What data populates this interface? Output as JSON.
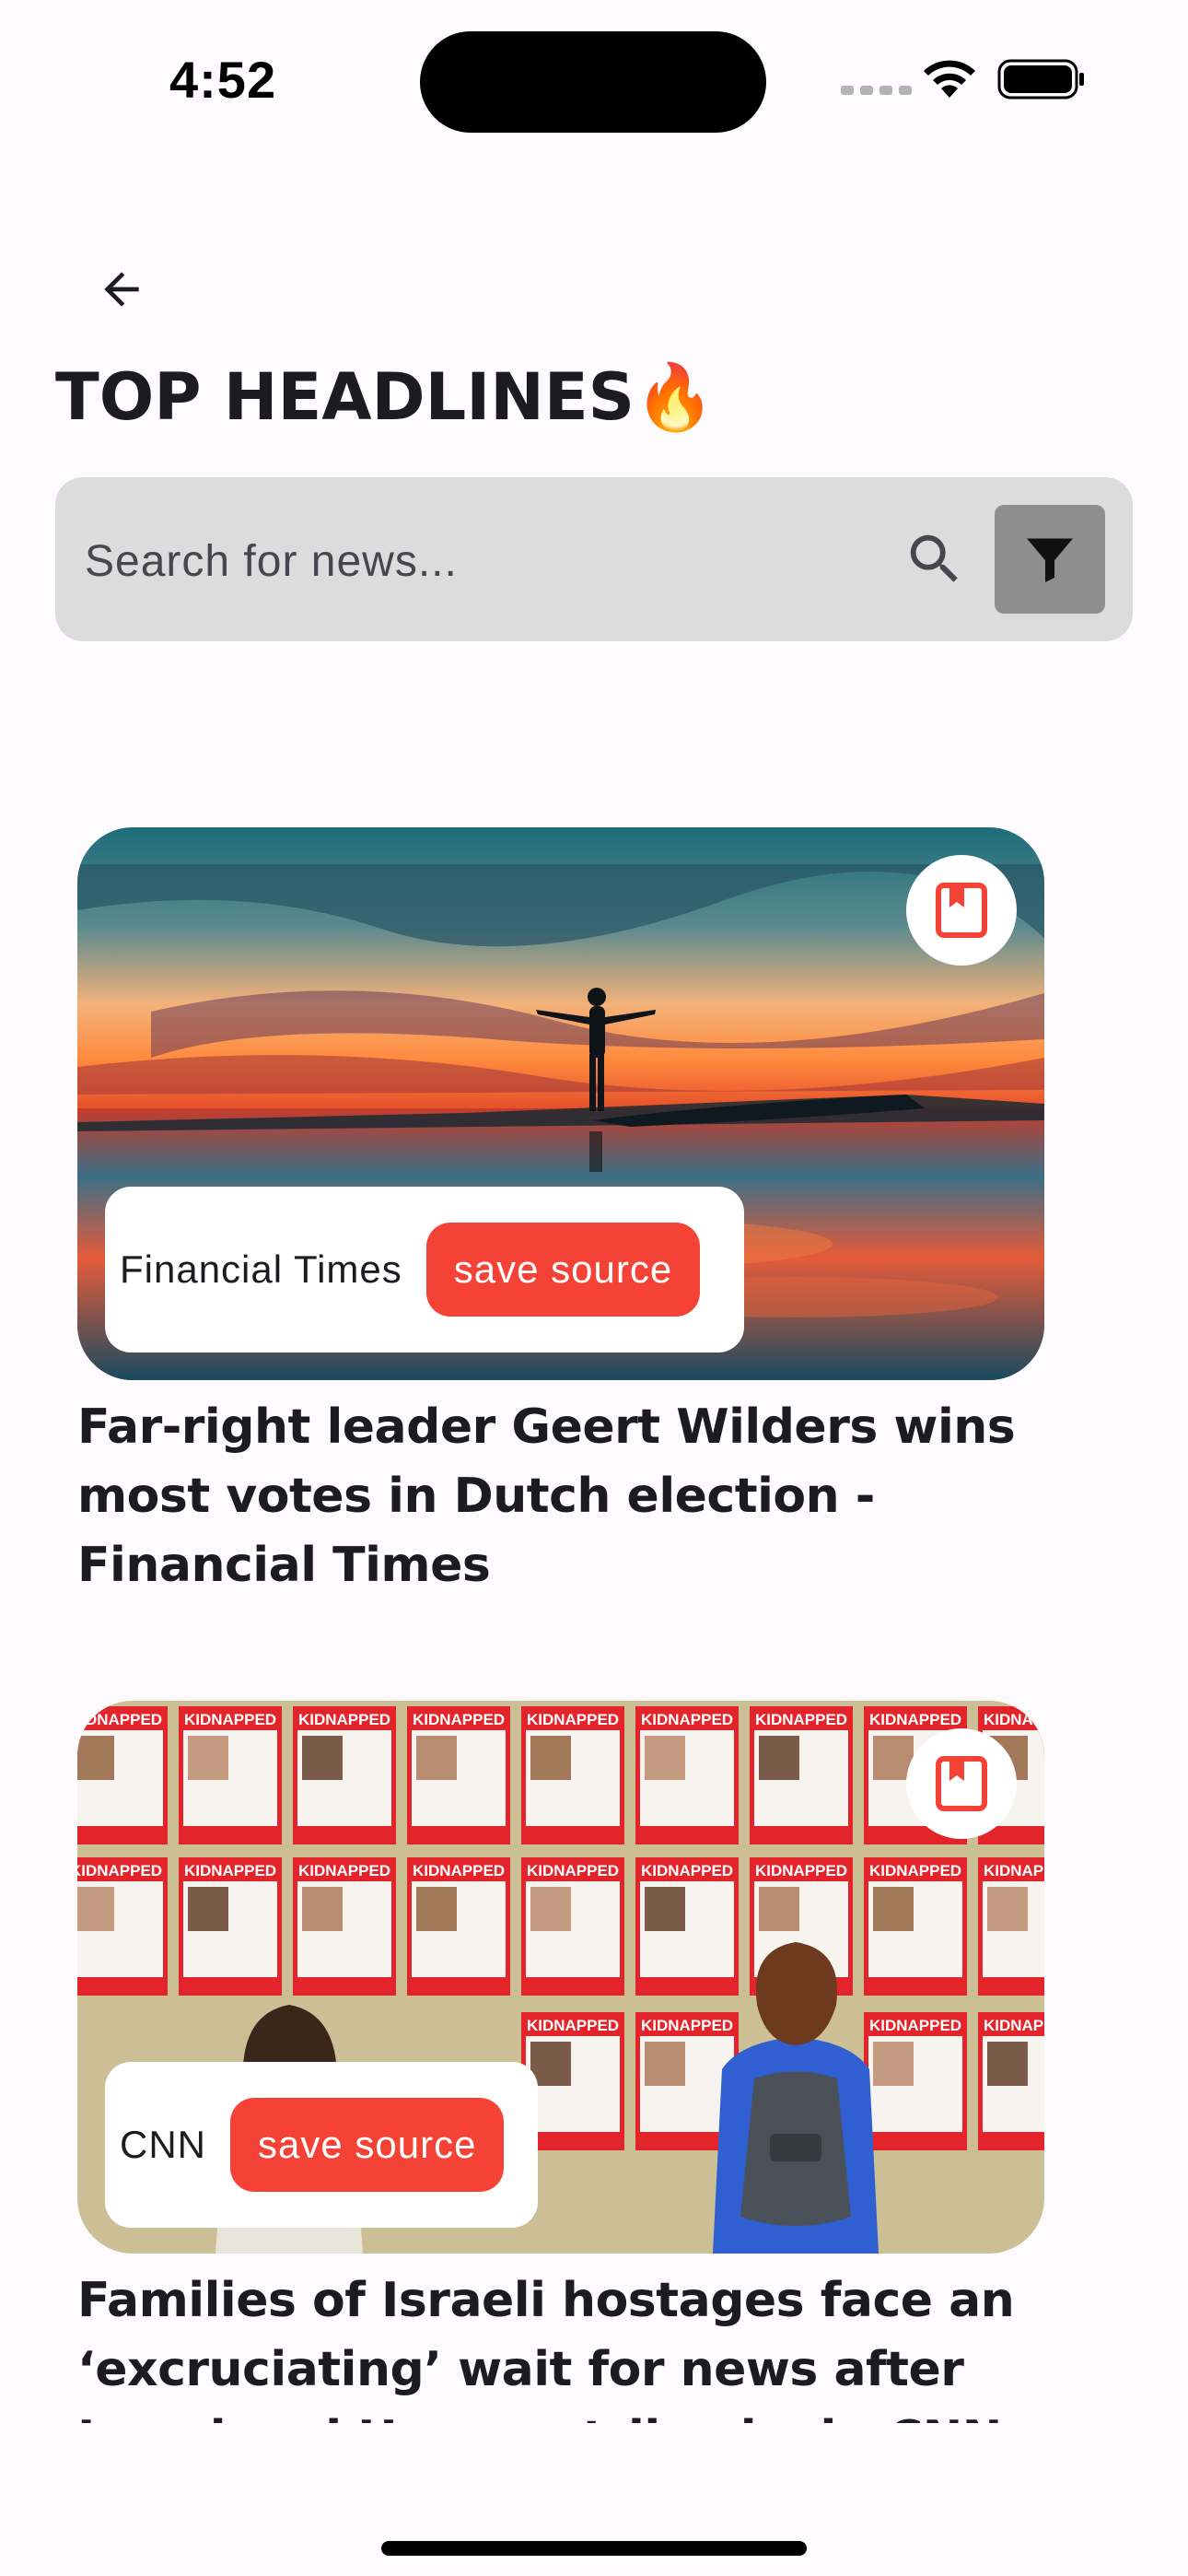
{
  "status_bar": {
    "time": "4:52"
  },
  "header": {
    "title": "TOP HEADLINES🔥"
  },
  "search": {
    "placeholder": "Search for news..."
  },
  "articles": [
    {
      "source": "Financial Times",
      "save_label": "save source",
      "headline": "Far-right leader Geert Wilders wins most votes in Dutch election - Financial Times"
    },
    {
      "source": "CNN",
      "save_label": "save source",
      "headline": "Families of Israeli hostages face an ‘excruciating’ wait for news after Israel and Hamas strike deal - CNN"
    }
  ],
  "poster_text": "KIDNAPPED",
  "colors": {
    "accent": "#f44336",
    "background": "#fefbff",
    "search_bg": "#dcdcdc",
    "filter_bg": "#8e8e8e"
  },
  "icons": [
    "back-arrow-icon",
    "search-icon",
    "filter-icon",
    "bookmark-icon"
  ]
}
